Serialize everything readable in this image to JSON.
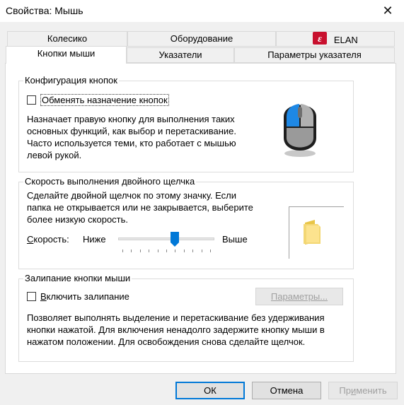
{
  "window": {
    "title": "Свойства: Мышь",
    "close_glyph": "✕"
  },
  "tabs_back": [
    {
      "label": "Колесико"
    },
    {
      "label": "Оборудование"
    },
    {
      "label": "ELAN"
    }
  ],
  "tabs_front": [
    {
      "label": "Кнопки мыши"
    },
    {
      "label": "Указатели"
    },
    {
      "label": "Параметры указателя"
    }
  ],
  "button_config": {
    "legend": "Конфигурация кнопок",
    "swap_label": "Обменять назначение кнопок",
    "swap_checked": false,
    "description": "Назначает правую кнопку для выполнения таких основных функций, как выбор и перетаскивание. Часто используется теми, кто работает с мышью левой рукой.",
    "mouse_icon": "mouse-icon"
  },
  "double_click": {
    "legend": "Скорость выполнения двойного щелчка",
    "description": "Сделайте двойной щелчок по этому значку. Если папка не открывается или не закрывается, выберите более низкую скорость.",
    "speed_label": "Скорость:",
    "slow_label": "Ниже",
    "fast_label": "Выше",
    "speed_value": 0.6,
    "folder_icon": "folder-icon"
  },
  "click_lock": {
    "legend": "Залипание кнопки мыши",
    "enable_label": "Включить залипание",
    "enable_checked": false,
    "settings_button": "Параметры...",
    "description": "Позволяет выполнять выделение и перетаскивание без удерживания кнопки нажатой. Для включения ненадолго задержите кнопку мыши в нажатом положении. Для освобождения снова сделайте щелчок."
  },
  "footer": {
    "ok": "ОК",
    "cancel": "Отмена",
    "apply": "Применить"
  }
}
